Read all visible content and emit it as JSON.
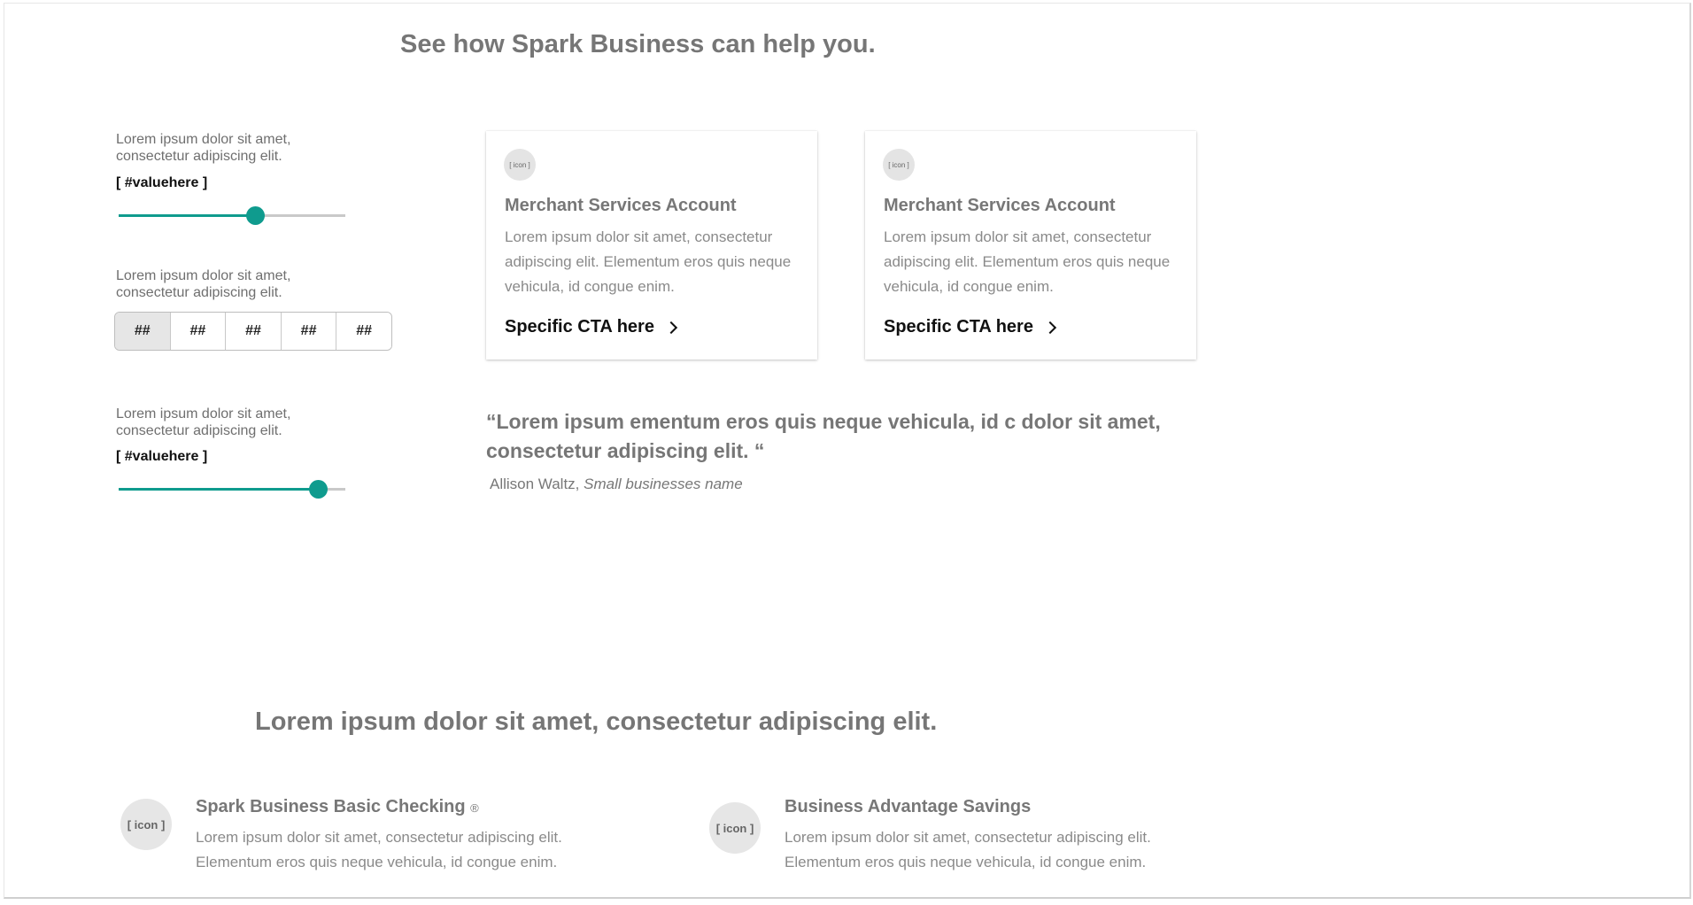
{
  "page": {
    "heading": "See how Spark Business can help you."
  },
  "calculator": {
    "slider1": {
      "label": "Lorem ipsum dolor sit amet, consectetur adipiscing elit.",
      "value_label": "[ #valuehere ]",
      "level": 0.6
    },
    "segmented": {
      "label": "Lorem ipsum dolor sit amet, consectetur adipiscing elit.",
      "options": [
        "##",
        "##",
        "##",
        "##",
        "##"
      ],
      "selected_index": 0
    },
    "slider2": {
      "label": "Lorem ipsum dolor sit amet, consectetur adipiscing elit.",
      "value_label": "[ #valuehere ]",
      "level": 0.88
    }
  },
  "cards": [
    {
      "icon_text": "[ icon ]",
      "title": "Merchant Services Account",
      "body": "Lorem ipsum dolor sit amet, consectetur adipiscing elit.  Elementum eros quis neque vehicula, id congue enim.",
      "cta": "Specific CTA here"
    },
    {
      "icon_text": "[ icon ]",
      "title": "Merchant Services Account",
      "body": "Lorem ipsum dolor sit amet, consectetur adipiscing elit.  Elementum eros quis neque vehicula, id congue enim.",
      "cta": "Specific CTA here"
    }
  ],
  "testimonial": {
    "quote": "“Lorem ipsum ementum eros quis neque vehicula, id c dolor sit amet, consectetur adipiscing elit. “",
    "author": "Allison Waltz,",
    "business": "Small businesses name"
  },
  "products_section": {
    "heading": "Lorem ipsum dolor sit amet, consectetur adipiscing elit.",
    "items": [
      {
        "icon_text": "[ icon ]",
        "title": "Spark Business Basic Checking",
        "mark": "®",
        "body": "Lorem ipsum dolor sit amet, consectetur adipiscing elit. Elementum eros quis neque vehicula, id congue enim."
      },
      {
        "icon_text": "[ icon ]",
        "title": "Business Advantage Savings",
        "body": "Lorem ipsum dolor sit amet, consectetur adipiscing elit. Elementum eros quis neque vehicula, id congue enim."
      }
    ]
  },
  "colors": {
    "accent": "#0f9b8e",
    "heading_gray": "#767676"
  }
}
